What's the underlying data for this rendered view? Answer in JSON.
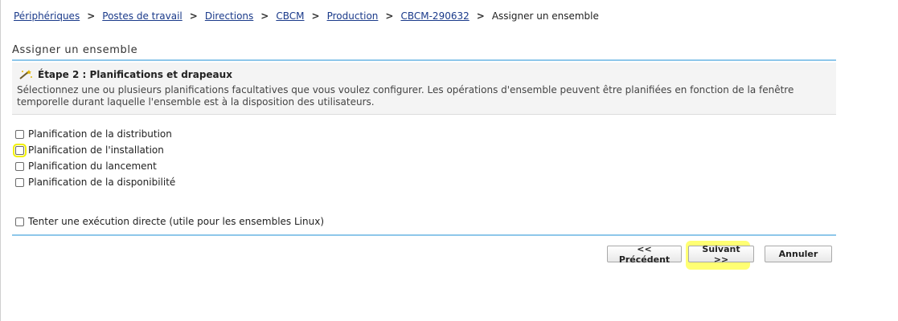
{
  "breadcrumb": {
    "items": [
      "Périphériques",
      "Postes de travail",
      "Directions",
      "CBCM",
      "Production",
      "CBCM-290632"
    ],
    "current": "Assigner un ensemble"
  },
  "page": {
    "title": "Assigner un ensemble"
  },
  "step": {
    "title": "Étape 2 : Planifications et drapeaux",
    "description": "Sélectionnez une ou plusieurs planifications facultatives que vous voulez configurer. Les opérations d'ensemble peuvent être planifiées en fonction de la fenêtre temporelle durant laquelle l'ensemble est à la disposition des utilisateurs."
  },
  "options": [
    {
      "label": "Planification de la distribution",
      "checked": false
    },
    {
      "label": "Planification de l'installation",
      "checked": false,
      "highlighted": true
    },
    {
      "label": "Planification du lancement",
      "checked": false
    },
    {
      "label": "Planification de la disponibilité",
      "checked": false
    }
  ],
  "direct_execution": {
    "label": "Tenter une exécution directe (utile pour les ensembles Linux)",
    "checked": false
  },
  "buttons": {
    "previous": "<< Précédent",
    "next": "Suivant >>",
    "cancel": "Annuler"
  },
  "colors": {
    "accent_rule": "#8ec7ea",
    "link": "#1a3a8a",
    "highlight": "#f2f000"
  }
}
